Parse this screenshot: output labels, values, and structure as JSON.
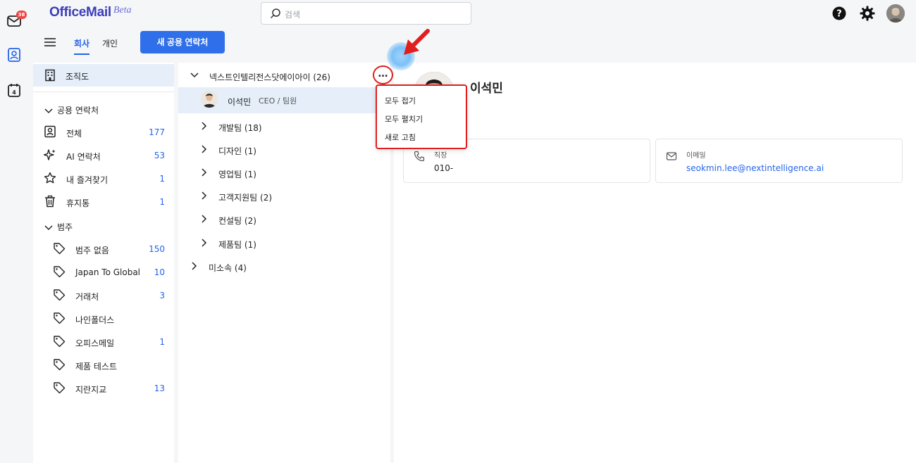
{
  "app": {
    "logo": "OfficeMail",
    "logo_badge": "Beta",
    "mail_badge": "38",
    "calendar_day": "4"
  },
  "search": {
    "placeholder": "검색"
  },
  "toolbar": {
    "tabs": [
      {
        "label": "회사",
        "active": true
      },
      {
        "label": "개인",
        "active": false
      }
    ],
    "new_button": "새 공용 연락처"
  },
  "sidebar": {
    "org_chart": "조직도",
    "shared_header": "공용 연락처",
    "shared_items": [
      {
        "label": "전체",
        "count": "177",
        "icon": "contact-card-icon"
      },
      {
        "label": "AI 연락처",
        "count": "53",
        "icon": "ai-sparkle-icon"
      },
      {
        "label": "내 즐겨찾기",
        "count": "1",
        "icon": "star-icon"
      },
      {
        "label": "휴지통",
        "count": "1",
        "icon": "trash-icon"
      }
    ],
    "category_header": "범주",
    "categories": [
      {
        "label": "범주 없음",
        "count": "150"
      },
      {
        "label": "Japan To Global",
        "count": "10"
      },
      {
        "label": "거래처",
        "count": "3"
      },
      {
        "label": "나인폴더스",
        "count": ""
      },
      {
        "label": "오피스메일",
        "count": "1"
      },
      {
        "label": "제품 테스트",
        "count": ""
      },
      {
        "label": "지란지교",
        "count": "13"
      }
    ]
  },
  "tree": {
    "root": "넥스트인텔리전스닷에이아이 (26)",
    "selected_person": {
      "name": "이석민",
      "role": "CEO / 팀원"
    },
    "teams": [
      "개발팀 (18)",
      "디자인 (1)",
      "영업팀 (1)",
      "고객지원팀 (2)",
      "컨설팅 (2)",
      "제품팀 (1)"
    ],
    "unassigned": "미소속 (4)"
  },
  "more_button": "…",
  "menu": {
    "items": [
      "모두 접기",
      "모두 펼치기",
      "새로 고침"
    ]
  },
  "detail": {
    "name": "이석민",
    "phone_label": "직장",
    "phone_value": "010-",
    "email_label": "이메일",
    "email_value": "seokmin.lee@nextintelligence.ai"
  },
  "colors": {
    "accent": "#2f6fe9",
    "selected_bg": "#e5eef9",
    "highlight_red": "#e11d1d"
  }
}
